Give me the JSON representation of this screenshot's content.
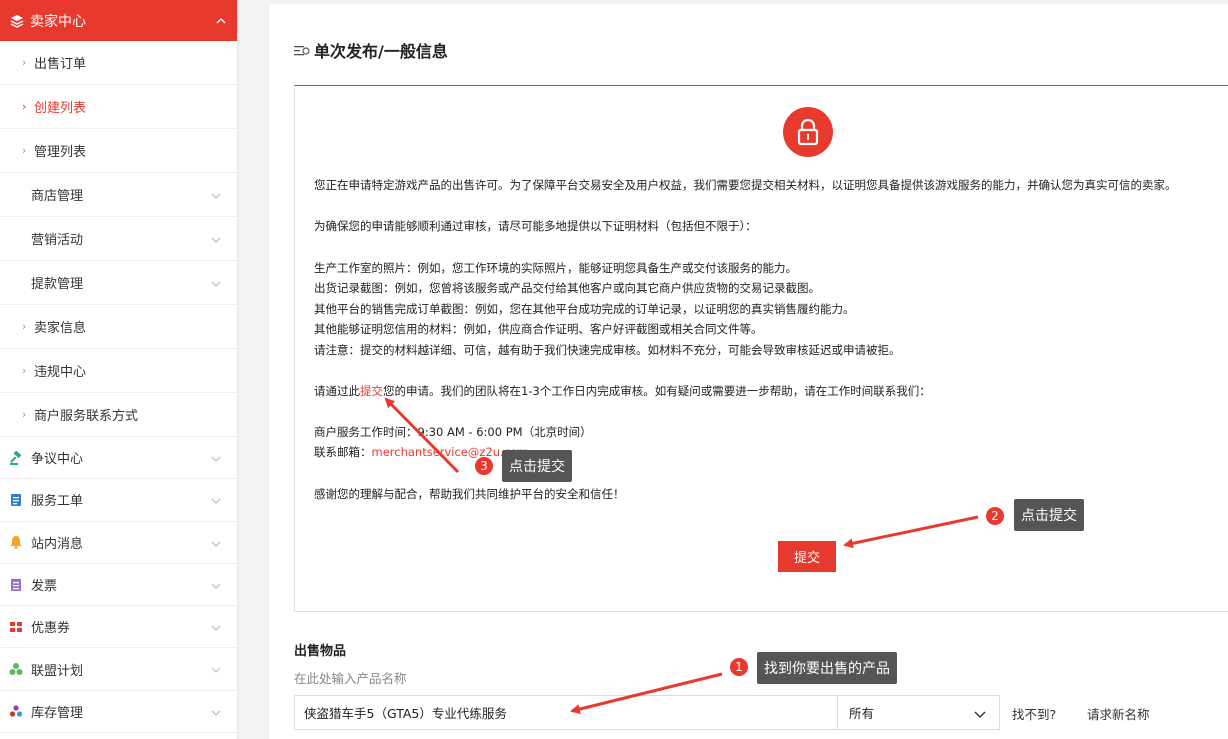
{
  "sidebar": {
    "header": "卖家中心",
    "sub_items": [
      {
        "label": "出售订单"
      },
      {
        "label": "创建列表"
      },
      {
        "label": "管理列表"
      },
      {
        "label": "商店管理"
      },
      {
        "label": "营销活动"
      },
      {
        "label": "提款管理"
      },
      {
        "label": "卖家信息"
      },
      {
        "label": "违规中心"
      },
      {
        "label": "商户服务联系方式"
      }
    ],
    "main_items": [
      {
        "label": "争议中心"
      },
      {
        "label": "服务工单"
      },
      {
        "label": "站内消息"
      },
      {
        "label": "发票"
      },
      {
        "label": "优惠券"
      },
      {
        "label": "联盟计划"
      },
      {
        "label": "库存管理"
      }
    ]
  },
  "page": {
    "title": "单次发布/一般信息"
  },
  "notice": {
    "intro": "您正在申请特定游戏产品的出售许可。为了保障平台交易安全及用户权益，我们需要您提交相关材料，以证明您具备提供该游戏服务的能力，并确认您为真实可信的卖家。",
    "materials_heading": "为确保您的申请能够顺利通过审核，请尽可能多地提供以下证明材料（包括但不限于）：",
    "materials": [
      "生产工作室的照片：例如，您工作环境的实际照片，能够证明您具备生产或交付该服务的能力。",
      "出货记录截图：例如，您曾将该服务或产品交付给其他客户或向其它商户供应货物的交易记录截图。",
      "其他平台的销售完成订单截图：例如，您在其他平台成功完成的订单记录，以证明您的真实销售履约能力。",
      "其他能够证明您信用的材料：例如，供应商合作证明、客户好评截图或相关合同文件等。",
      "请注意：提交的材料越详细、可信，越有助于我们快速完成审核。如材料不充分，可能会导致审核延迟或申请被拒。"
    ],
    "submit_prefix": "请通过此",
    "submit_link": "提交",
    "submit_suffix": "您的申请。我们的团队将在1-3个工作日内完成审核。如有疑问或需要进一步帮助，请在工作时间联系我们：",
    "hours": "商户服务工作时间：9:30 AM - 6:00 PM（北京时间）",
    "email_label": "联系邮箱：",
    "email": "merchantservice@z2u.com",
    "thanks": "感谢您的理解与配合，帮助我们共同维护平台的安全和信任！",
    "submit_button": "提交"
  },
  "sale": {
    "title": "出售物品",
    "hint": "在此处输入产品名称",
    "product_value": "侠盗猎车手5（GTA5）专业代练服务",
    "select_value": "所有",
    "not_found": "找不到?",
    "request_name": "请求新名称"
  },
  "annotations": [
    {
      "number": "1",
      "text": "找到你要出售的产品"
    },
    {
      "number": "2",
      "text": "点击提交"
    },
    {
      "number": "3",
      "text": "点击提交"
    }
  ],
  "colors": {
    "accent": "#e8392e",
    "callout": "#555555"
  }
}
